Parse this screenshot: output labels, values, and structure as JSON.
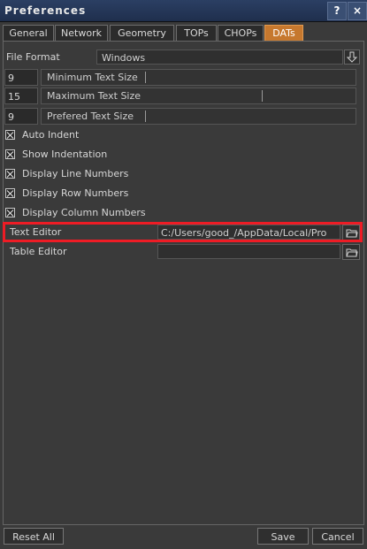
{
  "window": {
    "title": "Preferences",
    "help_label": "?",
    "close_label": "×"
  },
  "tabs": [
    {
      "label": "General"
    },
    {
      "label": "Network"
    },
    {
      "label": "Geometry"
    },
    {
      "label": "TOPs"
    },
    {
      "label": "CHOPs"
    },
    {
      "label": "DATs"
    }
  ],
  "active_tab": "DATs",
  "file_format": {
    "label": "File Format",
    "value": "Windows"
  },
  "sliders": [
    {
      "value": "9",
      "label": "Minimum Text Size"
    },
    {
      "value": "15",
      "label": "Maximum Text Size"
    },
    {
      "value": "9",
      "label": "Prefered Text Size"
    }
  ],
  "checkboxes": [
    {
      "label": "Auto Indent",
      "checked": true
    },
    {
      "label": "Show Indentation",
      "checked": true
    },
    {
      "label": "Display Line Numbers",
      "checked": true
    },
    {
      "label": "Display Row Numbers",
      "checked": true
    },
    {
      "label": "Display Column Numbers",
      "checked": true
    }
  ],
  "text_editor": {
    "label": "Text Editor",
    "value": "C:/Users/good_/AppData/Local/Pro"
  },
  "table_editor": {
    "label": "Table Editor",
    "value": ""
  },
  "footer": {
    "reset_label": "Reset All",
    "save_label": "Save",
    "cancel_label": "Cancel"
  },
  "colors": {
    "titlebar": "#2b3f63",
    "active_tab": "#c6782e",
    "highlight": "#ee1c25",
    "background": "#3a3a3a"
  }
}
